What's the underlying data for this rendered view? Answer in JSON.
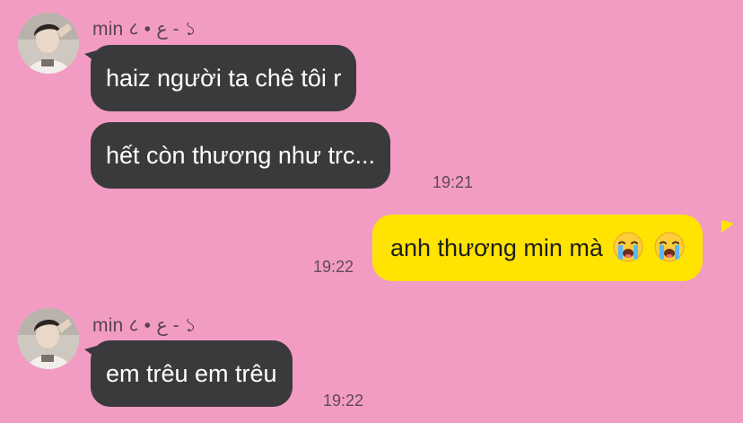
{
  "conversation": {
    "messages": [
      {
        "direction": "incoming",
        "sender": "min ८ • ع - ১",
        "text": "haiz người ta chê tôi r",
        "time": ""
      },
      {
        "direction": "incoming",
        "sender": "",
        "text": "hết còn thương như trc...",
        "time": "19:21"
      },
      {
        "direction": "outgoing",
        "sender": "",
        "text": "anh thương min mà",
        "emoji": [
          "loudly-crying-face",
          "loudly-crying-face"
        ],
        "time": "19:22"
      },
      {
        "direction": "incoming",
        "sender": "min ८ • ع - ১",
        "text": "em trêu em trêu",
        "time": "19:22"
      }
    ]
  },
  "colors": {
    "background": "#f39cc3",
    "incoming_bubble": "#3a3a3c",
    "outgoing_bubble": "#ffe301"
  }
}
